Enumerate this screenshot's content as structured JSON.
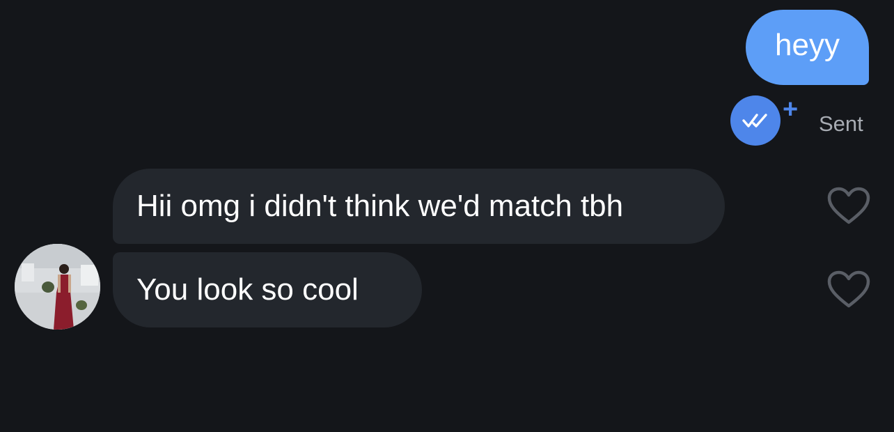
{
  "conversation": {
    "outgoing": [
      {
        "text": "heyy"
      }
    ],
    "status": {
      "label": "Sent",
      "icon": "double-check-icon",
      "plus": "+"
    },
    "incoming": [
      {
        "text": "Hii omg i didn't think we'd match tbh",
        "reaction_icon": "heart-icon"
      },
      {
        "text": "You look so cool",
        "reaction_icon": "heart-icon"
      }
    ],
    "sender_avatar": "avatar-photo"
  },
  "colors": {
    "background": "#14161a",
    "outgoing_bubble": "#5d9ef7",
    "incoming_bubble": "#23272d",
    "read_receipt": "#4e86ea",
    "status_text": "#a8acb3",
    "heart_outline": "#5a5e66"
  }
}
